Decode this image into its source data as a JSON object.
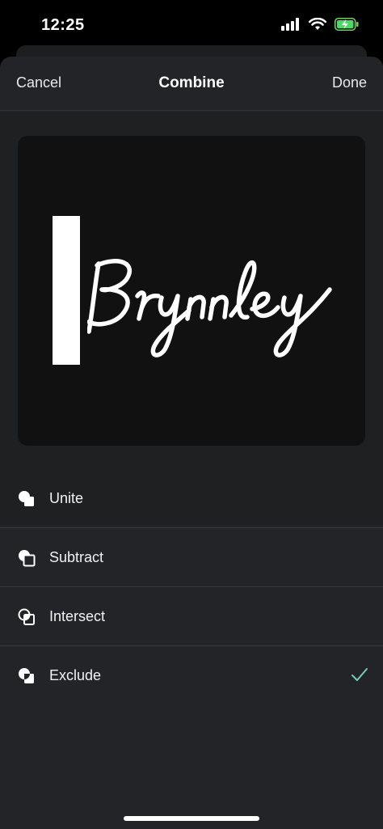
{
  "status_bar": {
    "time": "12:25"
  },
  "nav": {
    "cancel_label": "Cancel",
    "title": "Combine",
    "done_label": "Done"
  },
  "preview": {
    "text": "Brynnley"
  },
  "options": [
    {
      "label": "Unite",
      "icon": "unite-icon",
      "selected": false
    },
    {
      "label": "Subtract",
      "icon": "subtract-icon",
      "selected": false
    },
    {
      "label": "Intersect",
      "icon": "intersect-icon",
      "selected": false
    },
    {
      "label": "Exclude",
      "icon": "exclude-icon",
      "selected": true
    }
  ],
  "colors": {
    "check": "#6fd0b8",
    "background": "#232427"
  }
}
